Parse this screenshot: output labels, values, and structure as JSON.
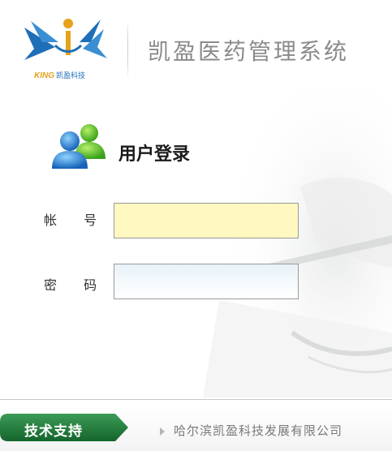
{
  "header": {
    "logo_word": "KING",
    "logo_cn": "凯盈科技",
    "app_title": "凯盈医药管理系统"
  },
  "login": {
    "icon": "users-icon",
    "title": "用户登录",
    "account_label": "帐 号",
    "account_value": "",
    "password_label": "密 码",
    "password_value": ""
  },
  "footer": {
    "support_label": "技术支持",
    "company": "哈尔滨凯盈科技发展有限公司"
  },
  "colors": {
    "account_field_bg": "#fff8c0",
    "password_field_bg": "#e8f2f8",
    "support_tab": "#1e7a3a",
    "logo_orange": "#e6a21a",
    "logo_blue": "#1e6fb8"
  }
}
